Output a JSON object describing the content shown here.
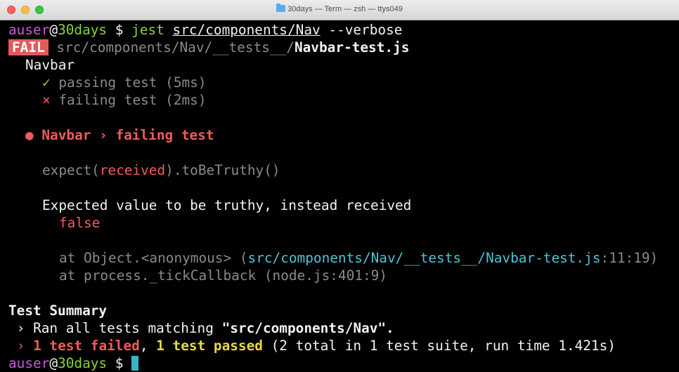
{
  "window": {
    "title": "30days — Term — zsh — ttys049"
  },
  "prompt": {
    "user": "auser",
    "at": "@",
    "host": "30days",
    "symbol": " $ ",
    "command_name": "jest",
    "command_path": "src/components/Nav",
    "command_flag": "--verbose"
  },
  "result_line": {
    "status": "FAIL",
    "path_dir": "src/components/Nav/__tests__/",
    "path_file": "Navbar-test.js"
  },
  "suite": {
    "name": "Navbar",
    "tests": [
      {
        "mark": "✓",
        "label": "passing test (5ms)"
      },
      {
        "mark": "×",
        "label": "failing test (2ms)"
      }
    ]
  },
  "failure": {
    "bullet": "●",
    "heading": "Navbar › failing test",
    "expect_prefix": "expect(",
    "expect_arg": "received",
    "expect_suffix": ").toBeTruthy()",
    "message": "Expected value to be truthy, instead received",
    "received_value": "false",
    "stack": [
      {
        "prefix": "at Object.<anonymous> (",
        "location": "src/components/Nav/__tests__/Navbar-test.js",
        "pos": ":11:19)"
      },
      {
        "prefix": "at process._tickCallback (node.js:401:9)",
        "location": "",
        "pos": ""
      }
    ]
  },
  "summary": {
    "heading": "Test Summary",
    "ran_prefix": "Ran all tests matching ",
    "ran_pattern": "\"src/components/Nav\".",
    "failed": "1 test failed",
    "comma": ", ",
    "passed": "1 test passed",
    "details": " (2 total in 1 test suite, run time 1.421s)",
    "chevron": "›"
  }
}
